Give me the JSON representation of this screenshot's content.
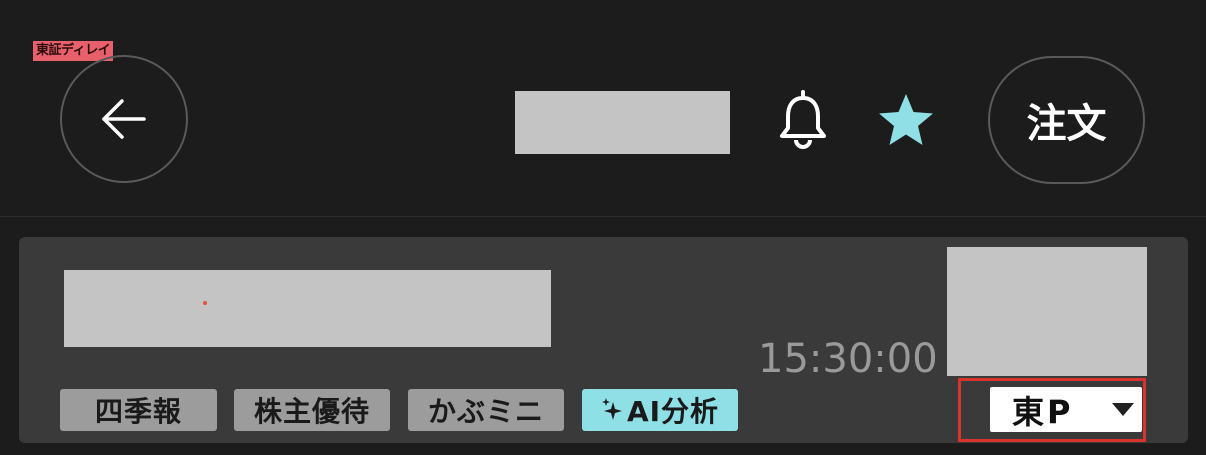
{
  "header": {
    "delay_badge": "東証ディレイ",
    "order_button": "注文",
    "icons": {
      "back": "arrow-left-icon",
      "alert": "bell-icon",
      "favorite": "star-icon"
    },
    "favorite_color": "#8fe0e6"
  },
  "stock_card": {
    "time": "15:30:00",
    "tags": [
      {
        "label": "四季報"
      },
      {
        "label": "株主優待"
      },
      {
        "label": "かぶミニ"
      },
      {
        "label": "AI分析",
        "icon": "sparkle-icon",
        "color": "#8fe0e6"
      }
    ],
    "market_select": {
      "value": "東P"
    }
  }
}
